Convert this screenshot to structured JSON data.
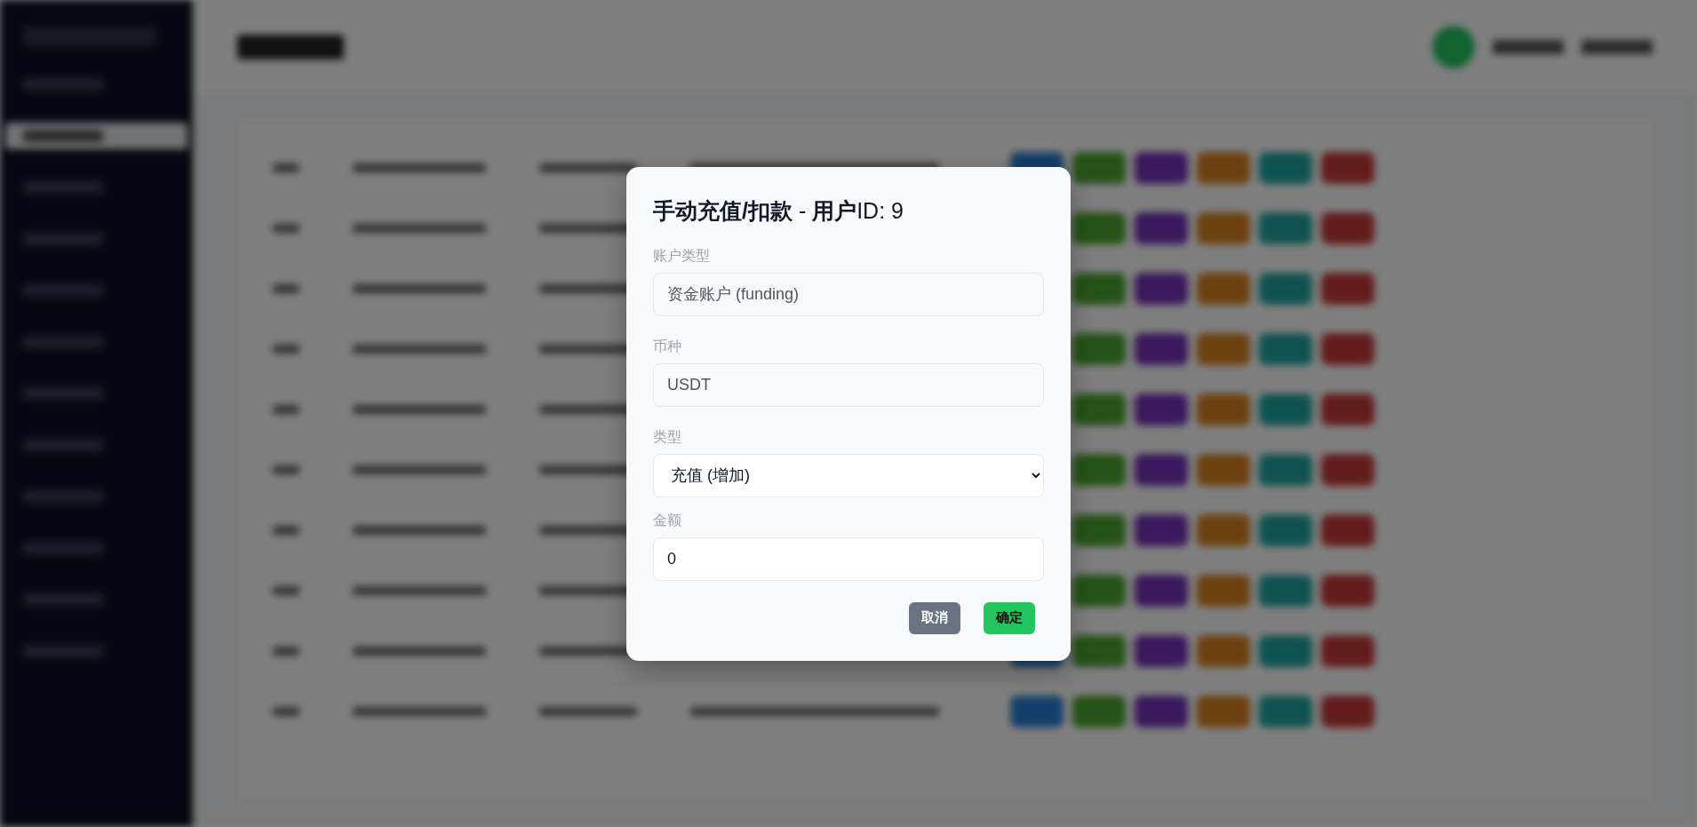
{
  "dialog": {
    "title": "**手动充值/扣款** - **用户**ID: 9",
    "fields": [
      {
        "kind": "input",
        "label": "账户类型",
        "value": "资金账户 (funding)",
        "disabled": true
      },
      {
        "kind": "input",
        "label": "币种",
        "value": "USDT",
        "disabled": true
      },
      {
        "kind": "select",
        "label": "类型",
        "value": "充值 (增加)",
        "disabled": false
      },
      {
        "kind": "input",
        "label": "金额",
        "value": "0",
        "disabled": false
      }
    ],
    "buttons": [
      {
        "label": "取消",
        "kind": "secondary"
      },
      {
        "label": "确定",
        "kind": "primary"
      }
    ]
  }
}
